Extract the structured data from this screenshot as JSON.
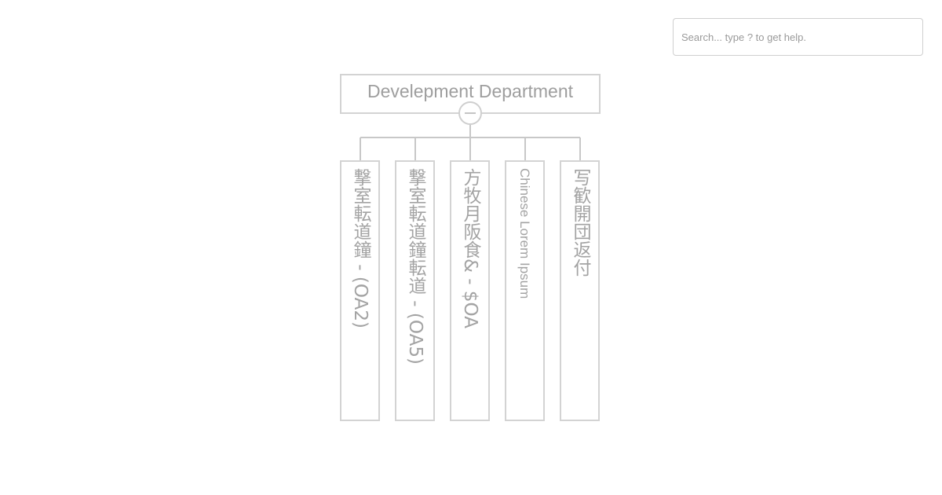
{
  "search": {
    "placeholder": "Search... type ? to get help."
  },
  "org_chart": {
    "root": {
      "title": "Develepment Department"
    },
    "children": [
      {
        "label": "撃室転道鐘 - (OA2)"
      },
      {
        "label": "撃室転道鐘転道 - (OA5)"
      },
      {
        "label": "方牧月阪食& - $OA"
      },
      {
        "label": "Chinese Lorem Ipsum"
      },
      {
        "label": "写歓開団返付"
      }
    ]
  }
}
